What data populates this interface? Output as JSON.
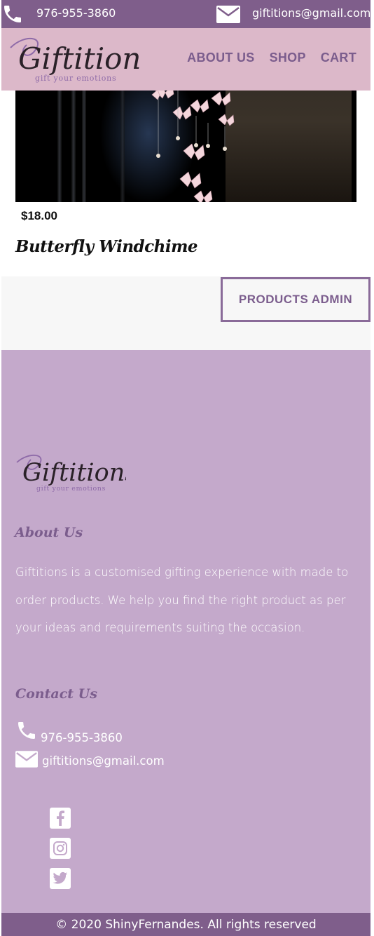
{
  "colors": {
    "accent": "#7f5e8b",
    "header_bg": "#dcb8c9",
    "footer_bg": "#c4a9cb",
    "text_purple": "#7b5d8d"
  },
  "topbar": {
    "phone": "976-955-3860",
    "email": "giftitions@gmail.com",
    "phone_icon": "phone-icon",
    "email_icon": "mail-icon"
  },
  "brand": {
    "name": "Giftitions",
    "tagline": "gift your emotions"
  },
  "nav": {
    "items": [
      {
        "label": "ABOUT US"
      },
      {
        "label": "SHOP"
      },
      {
        "label": "CART"
      }
    ]
  },
  "product": {
    "price": "$18.00",
    "title": "Butterfly Windchime"
  },
  "admin": {
    "label": "PRODUCTS ADMIN"
  },
  "footer": {
    "about_heading": "About Us",
    "about_text": "Giftitions is a customised gifting experience with made to order products. We help you find the right product as per your ideas and requirements suiting the occasion.",
    "contact_heading": "Contact Us",
    "phone": "976-955-3860",
    "email": "giftitions@gmail.com",
    "social": [
      "facebook-icon",
      "instagram-icon",
      "twitter-icon"
    ],
    "copyright": "© 2020 ShinyFernandes. All rights reserved"
  }
}
